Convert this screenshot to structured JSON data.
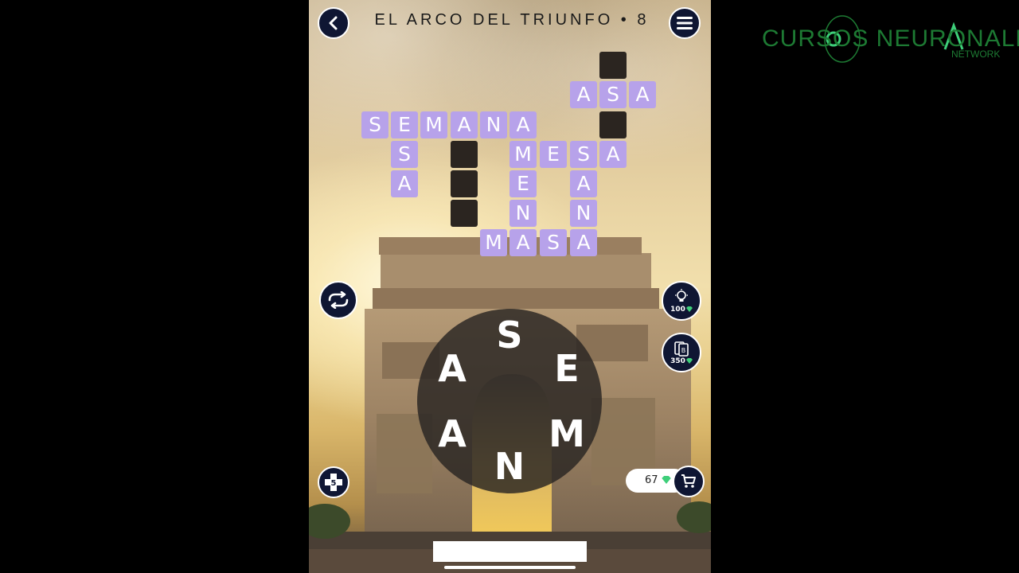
{
  "level": {
    "title": "EL ARCO DEL TRIUNFO • 8"
  },
  "grid": {
    "tiles": [
      {
        "letter": ""
      },
      {
        "letter": "A"
      },
      {
        "letter": "S"
      },
      {
        "letter": "A"
      },
      {
        "letter": "S"
      },
      {
        "letter": "E"
      },
      {
        "letter": "M"
      },
      {
        "letter": "A"
      },
      {
        "letter": "N"
      },
      {
        "letter": "A"
      },
      {
        "letter": ""
      },
      {
        "letter": "S"
      },
      {
        "letter": ""
      },
      {
        "letter": "M"
      },
      {
        "letter": "E"
      },
      {
        "letter": "S"
      },
      {
        "letter": "A"
      },
      {
        "letter": "A"
      },
      {
        "letter": ""
      },
      {
        "letter": "E"
      },
      {
        "letter": "A"
      },
      {
        "letter": ""
      },
      {
        "letter": "N"
      },
      {
        "letter": "N"
      },
      {
        "letter": "M"
      },
      {
        "letter": "A"
      },
      {
        "letter": "S"
      },
      {
        "letter": "A"
      }
    ]
  },
  "wheel": {
    "letters": [
      "S",
      "E",
      "M",
      "N",
      "A",
      "A"
    ]
  },
  "powerups": {
    "hint": {
      "cost": "100",
      "icon": "lightbulb-icon"
    },
    "reveal": {
      "cost": "350",
      "icon": "cards-icon"
    },
    "extra": {
      "count": "5",
      "icon": "plus-icon"
    }
  },
  "gems": {
    "count": "67",
    "icon": "gem-icon"
  },
  "icons": {
    "back": "chevron-left-icon",
    "menu": "hamburger-icon",
    "shuffle": "shuffle-icon",
    "cart": "cart-icon"
  },
  "watermark": {
    "main": "CURSOS NEURONALL",
    "sub": "NETWORK"
  },
  "colors": {
    "tile": "#b7a2ea",
    "empty_tile": "#2b2520",
    "button_bg": "#0f1633",
    "gem": "#3ecf7a",
    "brand": "#1d7a33"
  }
}
